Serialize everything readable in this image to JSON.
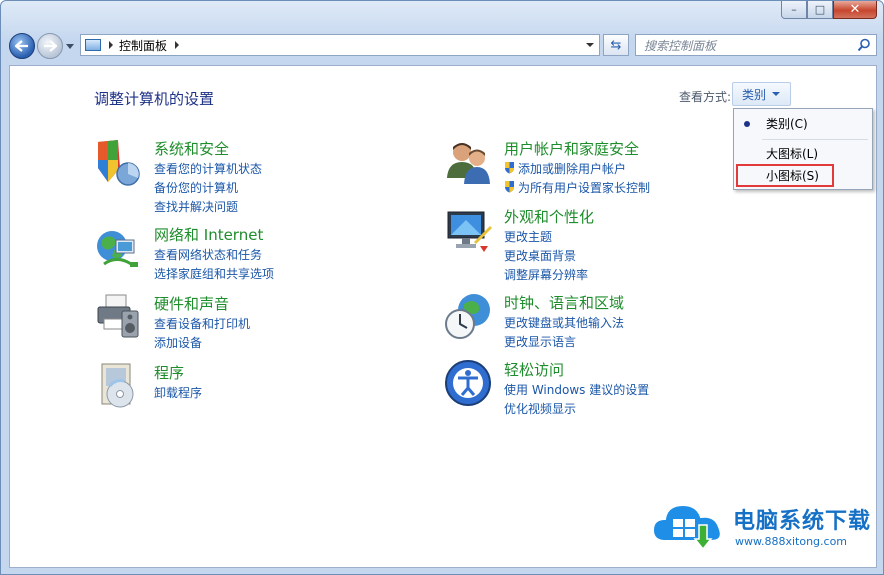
{
  "window": {
    "buttons": {
      "minimize": "–",
      "maximize": "□",
      "close": "✕"
    }
  },
  "address_bar": {
    "breadcrumb": "控制面板"
  },
  "search": {
    "placeholder": "搜索控制面板"
  },
  "page": {
    "title": "调整计算机的设置"
  },
  "view_by": {
    "label": "查看方式:",
    "value": "类别",
    "menu": [
      {
        "label": "类别(C)",
        "selected": true
      },
      {
        "label": "大图标(L)",
        "selected": false
      },
      {
        "label": "小图标(S)",
        "selected": false,
        "highlighted": true
      }
    ]
  },
  "categories": [
    {
      "title": "系统和安全",
      "icon": "shield-icon",
      "links": [
        "查看您的计算机状态",
        "备份您的计算机",
        "查找并解决问题"
      ]
    },
    {
      "title": "网络和 Internet",
      "icon": "network-globe-icon",
      "links": [
        "查看网络状态和任务",
        "选择家庭组和共享选项"
      ]
    },
    {
      "title": "硬件和声音",
      "icon": "printer-speaker-icon",
      "links": [
        "查看设备和打印机",
        "添加设备"
      ]
    },
    {
      "title": "程序",
      "icon": "program-disc-icon",
      "links": [
        "卸载程序"
      ]
    },
    {
      "title": "用户帐户和家庭安全",
      "icon": "users-icon",
      "links": [
        "添加或删除用户帐户",
        "为所有用户设置家长控制"
      ]
    },
    {
      "title": "外观和个性化",
      "icon": "monitor-icon",
      "links": [
        "更改主题",
        "更改桌面背景",
        "调整屏幕分辨率"
      ]
    },
    {
      "title": "时钟、语言和区域",
      "icon": "clock-globe-icon",
      "links": [
        "更改键盘或其他输入法",
        "更改显示语言"
      ]
    },
    {
      "title": "轻松访问",
      "icon": "ease-of-access-icon",
      "links": [
        "使用 Windows 建议的设置",
        "优化视频显示"
      ]
    }
  ],
  "watermark": {
    "title": "电脑系统下载",
    "url": "www.888xitong.com"
  },
  "colors": {
    "accent": "#1b57a8",
    "heading": "#1e8d2b",
    "highlight": "#e23a3a"
  }
}
